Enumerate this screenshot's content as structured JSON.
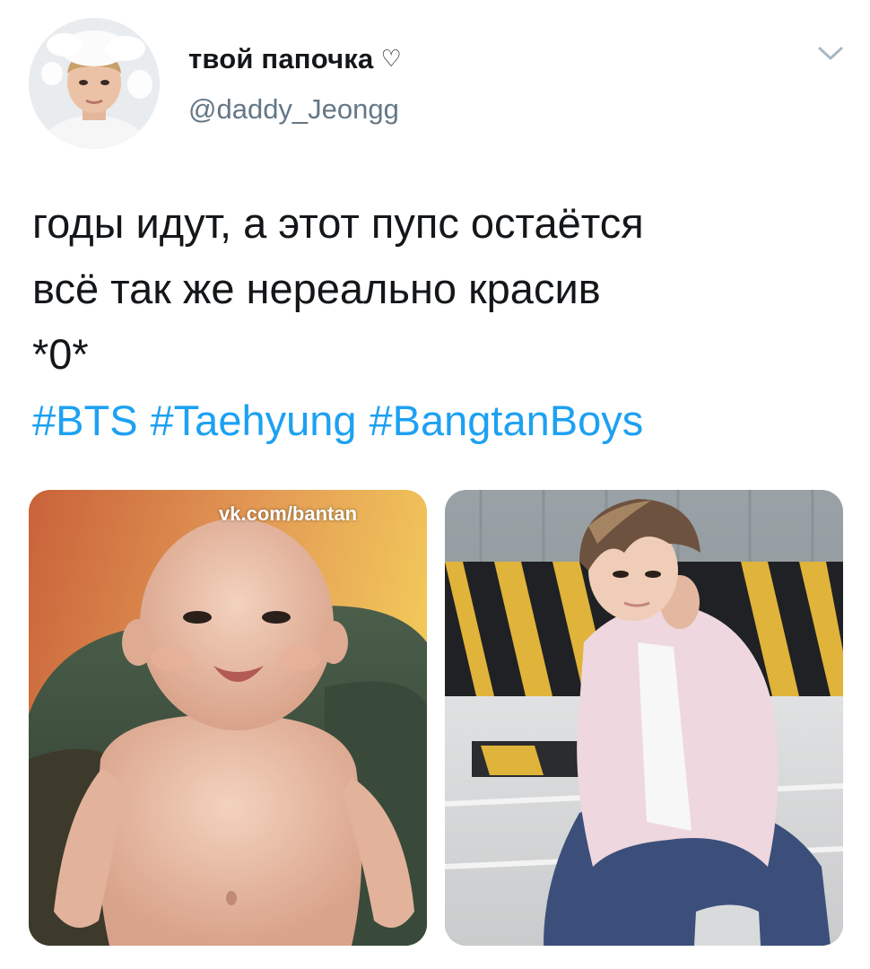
{
  "tweet": {
    "display_name": "твой папочка",
    "name_emoji": "♡",
    "username": "@daddy_Jeongg",
    "text_lines": [
      "годы идут, а этот пупс остаётся",
      "всё так же нереально красив",
      "*0*"
    ],
    "hashtags": [
      "#BTS",
      "#Taehyung",
      "#BangtanBoys"
    ],
    "media": {
      "watermark": "vk.com/bantan"
    }
  },
  "colors": {
    "link": "#1da1f2",
    "secondary_text": "#657786",
    "primary_text": "#14171a"
  },
  "icons": {
    "menu": "chevron-down-icon",
    "name_badge": "heart-outline-icon"
  }
}
